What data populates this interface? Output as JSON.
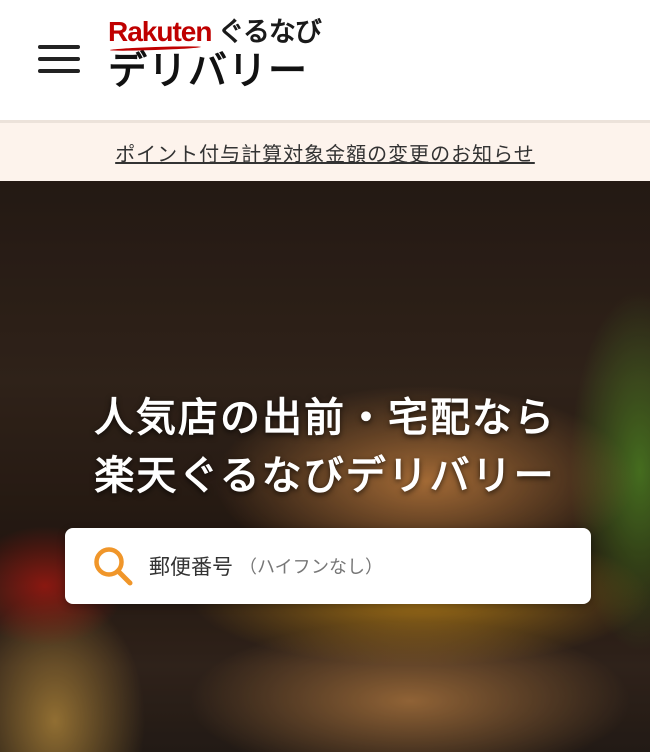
{
  "header": {
    "logo": {
      "rakuten": "Rakuten",
      "gurunavi": "ぐるなび",
      "delivery": "デリバリー"
    }
  },
  "notice": {
    "link_text": "ポイント付与計算対象金額の変更のお知らせ"
  },
  "hero": {
    "title_line1": "人気店の出前・宅配なら",
    "title_line2": "楽天ぐるなびデリバリー",
    "search": {
      "placeholder_main": "郵便番号",
      "placeholder_sub": "（ハイフンなし）"
    },
    "image": "hamburger-with-fries"
  },
  "colors": {
    "brand_red": "#bf0000",
    "search_icon": "#f0962a",
    "notice_bg": "#fdf3ec"
  }
}
